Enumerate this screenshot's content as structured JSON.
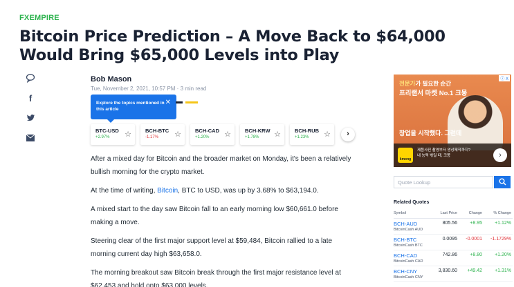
{
  "brand": {
    "logo_fx": "FX",
    "logo_rest": "EMPIRE"
  },
  "headline": "Bitcoin Price Prediction – A Move Back to $64,000 Would Bring $65,000 Levels into Play",
  "share_icons": [
    "comment-icon",
    "facebook-icon",
    "twitter-icon",
    "email-icon"
  ],
  "byline": {
    "author": "Bob Mason",
    "date": "Tue, November 2, 2021, 10:57 PM",
    "read_time": "3 min read"
  },
  "tooltip": {
    "text": "Explore the topics mentioned in this article",
    "close": "✕"
  },
  "chips": [
    {
      "symbol": "BTC-USD",
      "change": "+2.97%"
    },
    {
      "symbol": "BCH-BTC",
      "change": "-1.17%"
    },
    {
      "symbol": "BCH-CAD",
      "change": "+1.20%"
    },
    {
      "symbol": "BCH-KRW",
      "change": "+1.78%"
    },
    {
      "symbol": "BCH-RUB",
      "change": "+1.23%"
    }
  ],
  "article": {
    "p1": "After a mixed day for Bitcoin and the broader market on Monday, it's been a relatively bullish morning for the crypto market.",
    "p2_pre": "At the time of writing, ",
    "p2_link": "Bitcoin",
    "p2_post": ", BTC to USD, was up by 3.68% to $63,194.0.",
    "p3": "A mixed start to the day saw Bitcoin fall to an early morning low $60,661.0 before making a move.",
    "p4": "Steering clear of the first major support level at $59,484, Bitcoin rallied to a late morning current day high $63,658.0.",
    "p5": "The morning breakout saw Bitcoin break through the first major resistance level at $62,453 and hold onto $63,000 levels."
  },
  "ad": {
    "line1a": "전문가",
    "line1b": "가 필요한 순간",
    "line2": "프리랜서 마켓 No.1 크몽",
    "line3": "창업을 시작했다. 그런데",
    "line4a": "제품사진 촬영부터 영상제작까지?",
    "line4b": "내 능력 밖일 때, 크몽",
    "brand": "kmong",
    "badge": "ⓘ X"
  },
  "lookup": {
    "placeholder": "Quote Lookup"
  },
  "related": {
    "title": "Related Quotes",
    "headers": [
      "Symbol",
      "Last Price",
      "Change",
      "% Change"
    ],
    "rows": [
      {
        "symbol": "BCH-AUD",
        "name": "BitcoinCash AUD",
        "last": "805.56",
        "change": "+8.95",
        "pct": "+1.12%"
      },
      {
        "symbol": "BCH-BTC",
        "name": "BitcoinCash BTC",
        "last": "0.0095",
        "change": "-0.0001",
        "pct": "-1.1729%"
      },
      {
        "symbol": "BCH-CAD",
        "name": "BitcoinCash CAD",
        "last": "742.86",
        "change": "+8.80",
        "pct": "+1.20%"
      },
      {
        "symbol": "BCH-CNY",
        "name": "BitcoinCash CNY",
        "last": "3,830.60",
        "change": "+49.42",
        "pct": "+1.31%"
      }
    ]
  },
  "colors": {
    "accent": "#1a73e8",
    "positive": "#2bb24c",
    "negative": "#e0353b"
  }
}
